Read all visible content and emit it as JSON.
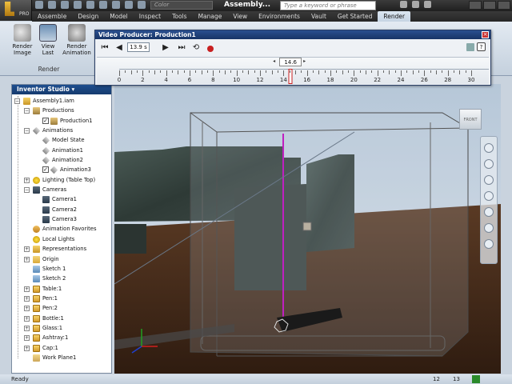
{
  "titlebar": {
    "app_badge": "PRO",
    "color_box": "Color",
    "document_title": "Assembly...",
    "search_placeholder": "Type a keyword or phrase"
  },
  "ribbon_tabs": [
    "Assemble",
    "Design",
    "Model",
    "Inspect",
    "Tools",
    "Manage",
    "View",
    "Environments",
    "Vault",
    "Get Started",
    "Render"
  ],
  "ribbon": {
    "buttons": [
      {
        "label_line1": "Render",
        "label_line2": "Image"
      },
      {
        "label_line1": "View",
        "label_line2": "Last"
      },
      {
        "label_line1": "Render",
        "label_line2": "Animation"
      }
    ],
    "panel_label": "Render"
  },
  "video_producer": {
    "title": "Video Producer: Production1",
    "time_field": "13.9 s",
    "current_time": "14.6",
    "current_time_value": 14.6,
    "tick_labels": [
      "0",
      "2",
      "4",
      "6",
      "8",
      "10",
      "12",
      "14",
      "16",
      "18",
      "20",
      "22",
      "24",
      "26",
      "28",
      "30"
    ],
    "range": [
      0,
      30
    ]
  },
  "browser": {
    "title": "Inventor Studio",
    "items": [
      {
        "label": "Assembly1.iam",
        "indent": 0,
        "icon": "assembly-icon",
        "toggle": "−"
      },
      {
        "label": "Productions",
        "indent": 1,
        "icon": "production-folder-icon",
        "toggle": "−"
      },
      {
        "label": "Production1",
        "indent": 2,
        "icon": "production-icon",
        "check": "✓"
      },
      {
        "label": "Animations",
        "indent": 1,
        "icon": "animation-folder-icon",
        "toggle": "−"
      },
      {
        "label": "Model State",
        "indent": 2,
        "icon": "animation-icon"
      },
      {
        "label": "Animation1",
        "indent": 2,
        "icon": "animation-icon"
      },
      {
        "label": "Animation2",
        "indent": 2,
        "icon": "animation-icon"
      },
      {
        "label": "Animation3",
        "indent": 2,
        "icon": "animation-icon",
        "check": "✓"
      },
      {
        "label": "Lighting (Table Top)",
        "indent": 1,
        "icon": "lighting-icon",
        "toggle": "+"
      },
      {
        "label": "Cameras",
        "indent": 1,
        "icon": "camera-folder-icon",
        "toggle": "−"
      },
      {
        "label": "Camera1",
        "indent": 2,
        "icon": "camera-icon"
      },
      {
        "label": "Camera2",
        "indent": 2,
        "icon": "camera-icon"
      },
      {
        "label": "Camera3",
        "indent": 2,
        "icon": "camera-icon"
      },
      {
        "label": "Animation Favorites",
        "indent": 1,
        "icon": "favorites-icon"
      },
      {
        "label": "Local Lights",
        "indent": 1,
        "icon": "local-lights-icon"
      },
      {
        "label": "Representations",
        "indent": 1,
        "icon": "representations-icon",
        "toggle": "+"
      },
      {
        "label": "Origin",
        "indent": 1,
        "icon": "origin-folder-icon",
        "toggle": "+"
      },
      {
        "label": "Sketch 1",
        "indent": 1,
        "icon": "sketch-icon"
      },
      {
        "label": "Sketch 2",
        "indent": 1,
        "icon": "sketch-icon"
      },
      {
        "label": "Table:1",
        "indent": 1,
        "icon": "part-icon",
        "toggle": "+"
      },
      {
        "label": "Pen:1",
        "indent": 1,
        "icon": "part-icon",
        "toggle": "+"
      },
      {
        "label": "Pen:2",
        "indent": 1,
        "icon": "part-icon",
        "toggle": "+"
      },
      {
        "label": "Bottle:1",
        "indent": 1,
        "icon": "part-icon",
        "toggle": "+"
      },
      {
        "label": "Glass:1",
        "indent": 1,
        "icon": "part-icon",
        "toggle": "+"
      },
      {
        "label": "Ashtray:1",
        "indent": 1,
        "icon": "part-icon",
        "toggle": "+"
      },
      {
        "label": "Cap:1",
        "indent": 1,
        "icon": "part-icon",
        "toggle": "+"
      },
      {
        "label": "Work Plane1",
        "indent": 1,
        "icon": "work-plane-icon"
      }
    ]
  },
  "viewcube_label": "FRONT",
  "status": {
    "left": "Ready",
    "n1": "12",
    "n2": "13"
  }
}
